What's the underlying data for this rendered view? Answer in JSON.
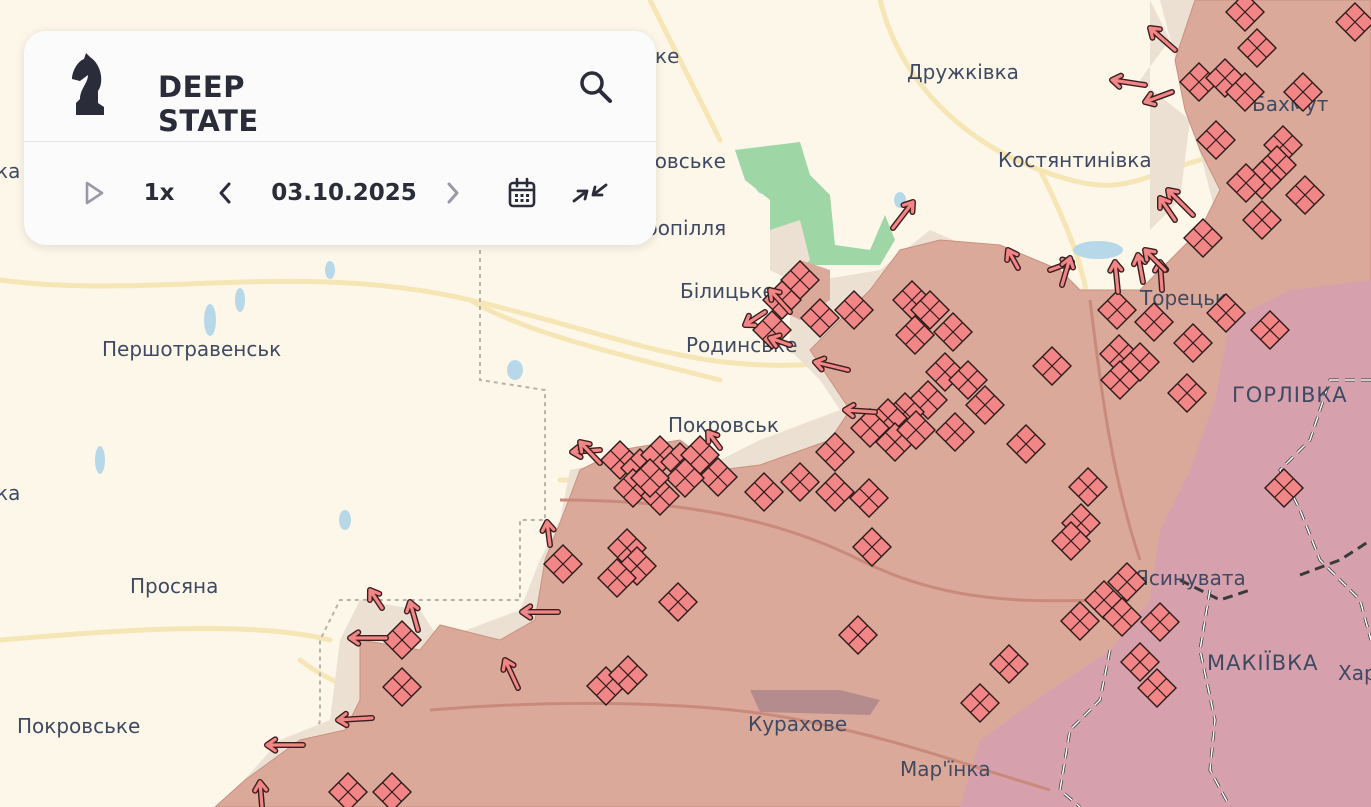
{
  "app": {
    "logo_line1": "DEEP",
    "logo_line2": "STATE",
    "speed": "1x",
    "date": "03.10.2025"
  },
  "icons": {
    "search": "search-icon",
    "play": "play-icon",
    "prev": "chevron-left-icon",
    "next": "chevron-right-icon",
    "calendar": "calendar-icon",
    "collapse": "collapse-arrows-icon",
    "logo": "knight-chess-piece-icon"
  },
  "colors": {
    "background": "#fdf7e9",
    "occupied": "#dba99a",
    "occupied_border": "#b57a6a",
    "contested": "#eadbcf",
    "crimea_zone": "#d7a0ad",
    "marker_fill": "#f28585",
    "marker_stroke": "#2a1a1a",
    "text": "#3f4a62",
    "water": "#b7d8e8",
    "park": "#9fd6a6"
  },
  "places": [
    {
      "id": "druzhkivka",
      "label": "Дружківка"
    },
    {
      "id": "kostiantynivka",
      "label": "Костянтинівка"
    },
    {
      "id": "bakhmut",
      "label": "Бахмут"
    },
    {
      "id": "dobropillia",
      "label": "ропілля"
    },
    {
      "id": "kramatorske",
      "label": "ке"
    },
    {
      "id": "rivne",
      "label": "ровське"
    },
    {
      "id": "bilytske",
      "label": "Білицьке"
    },
    {
      "id": "rodynske",
      "label": "Родинське"
    },
    {
      "id": "pershotravensk",
      "label": "Першотравенськ"
    },
    {
      "id": "pokrovsk",
      "label": "Покровськ"
    },
    {
      "id": "toretsk",
      "label": "Торецьк"
    },
    {
      "id": "horlivka",
      "label": "ГОРЛІВКА"
    },
    {
      "id": "prosiana",
      "label": "Просяна"
    },
    {
      "id": "yasynuvata",
      "label": "Ясинувата"
    },
    {
      "id": "makiivka",
      "label": "МАКІЇВКА"
    },
    {
      "id": "khartsyzk",
      "label": "Хар"
    },
    {
      "id": "pokrovske",
      "label": "Покровське"
    },
    {
      "id": "kurakhove",
      "label": "Курахове"
    },
    {
      "id": "marinka",
      "label": "Мар'їнка"
    },
    {
      "id": "edge_ka",
      "label": "ка"
    },
    {
      "id": "edge_ka2",
      "label": "ка"
    }
  ]
}
